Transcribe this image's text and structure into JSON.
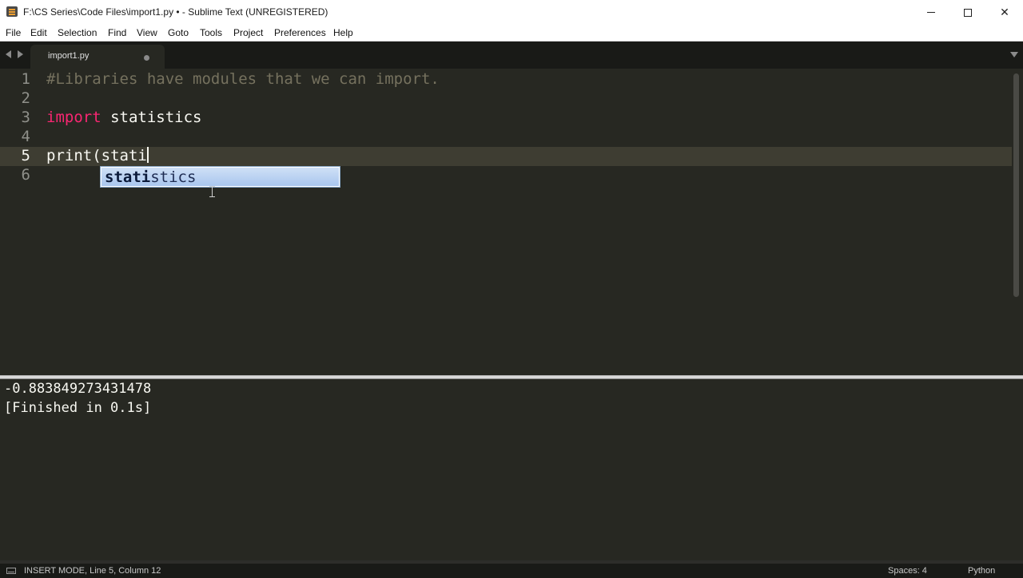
{
  "window": {
    "title": "F:\\CS Series\\Code Files\\import1.py • - Sublime Text (UNREGISTERED)",
    "close_glyph": "✕"
  },
  "menu": [
    {
      "label": "File"
    },
    {
      "label": "Edit"
    },
    {
      "label": "Selection"
    },
    {
      "label": "Find"
    },
    {
      "label": "View"
    },
    {
      "label": "Goto"
    },
    {
      "label": "Tools"
    },
    {
      "label": "Project"
    },
    {
      "label": "Preferences"
    },
    {
      "label": "Help"
    }
  ],
  "tab": {
    "label": "import1.py",
    "dirty": true
  },
  "editor": {
    "current_line": 5,
    "line_numbers": [
      "1",
      "2",
      "3",
      "4",
      "5",
      "6"
    ],
    "lines": {
      "comment": "#Libraries have modules that we can import.",
      "import_keyword": "import",
      "import_module": " statistics",
      "print_call": "print",
      "print_args": "(stati"
    },
    "colors": {
      "background": "#272822",
      "keyword": "#f92672",
      "comment": "#75715e",
      "text": "#f8f8f2"
    }
  },
  "autocomplete": {
    "typed": "stati",
    "rest": "stics"
  },
  "output": {
    "lines": [
      "-0.883849273431478",
      "[Finished in 0.1s]"
    ]
  },
  "status": {
    "mode": "INSERT MODE, Line 5, Column 12",
    "spaces": "Spaces: 4",
    "syntax": "Python"
  }
}
